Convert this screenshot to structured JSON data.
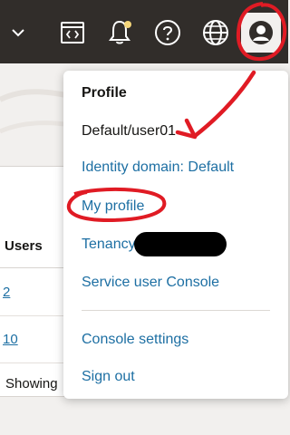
{
  "header": {
    "icons": [
      "chevron-down-icon",
      "code-editor-icon",
      "notifications-bell-icon",
      "help-icon",
      "language-globe-icon",
      "user-profile-icon"
    ],
    "notification_dot_color": "#f5d67a"
  },
  "background": {
    "table": {
      "column_header": "Users",
      "rows": [
        "2",
        "10"
      ]
    },
    "footer_text": "Showing"
  },
  "profile_menu": {
    "title": "Profile",
    "username": "Default/user01",
    "items": {
      "identity_domain": "Identity domain: Default",
      "my_profile": "My profile",
      "tenancy": "Tenancy:",
      "service_user_console": "Service user Console",
      "console_settings": "Console settings",
      "sign_out": "Sign out"
    }
  },
  "colors": {
    "topbar": "#312d2a",
    "link": "#1d6fa3",
    "annotation": "#e01b24"
  }
}
